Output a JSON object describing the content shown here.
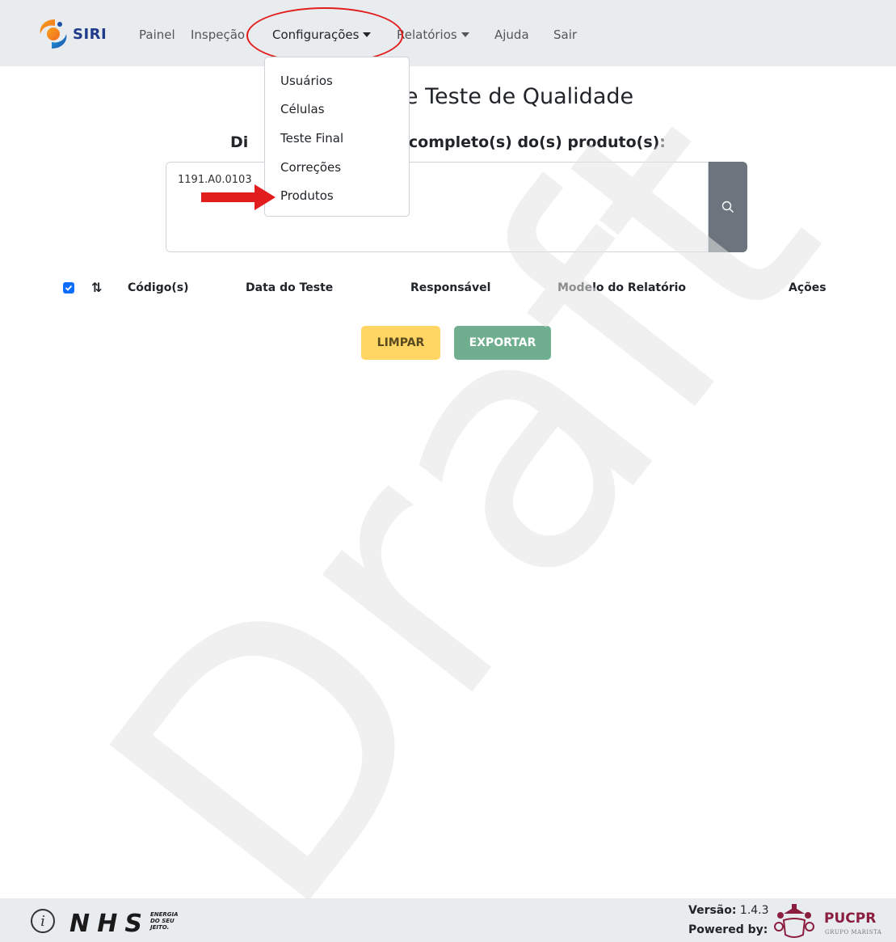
{
  "navbar": {
    "brand": "SIRI",
    "items": [
      {
        "label": "Painel"
      },
      {
        "label": "Inspeção"
      },
      {
        "label": "Configurações"
      },
      {
        "label": "Relatórios"
      },
      {
        "label": "Ajuda"
      },
      {
        "label": "Sair"
      }
    ]
  },
  "dropdown": {
    "items": [
      "Usuários",
      "Células",
      "Teste Final",
      "Correções",
      "Produtos"
    ]
  },
  "main": {
    "title": "e Teste de Qualidade",
    "subtitle": "Di                          s) completo(s) do(s) produto(s):",
    "search_value": "1191.A0.0103",
    "table_headers": [
      "Código(s)",
      "Data do Teste",
      "Responsável",
      "Modelo do Relatório",
      "Ações"
    ],
    "buttons": {
      "limpar": "LIMPAR",
      "exportar": "EXPORTAR"
    }
  },
  "watermark": "Draft",
  "footer": {
    "version_label": "Versão:",
    "version_value": "1.4.3",
    "powered_by": "Powered by:",
    "partner": "PUCPR",
    "partner_sub": "GRUPO MARISTA",
    "nhs_tagline": [
      "ENERGIA",
      "DO SEU",
      "JEITO."
    ]
  },
  "colors": {
    "navbar_bg": "#e9ecef",
    "limpar": "#ffd664",
    "exportar": "#6fae8f",
    "search_button": "#6c757d",
    "annotation": "#e11d1d"
  },
  "icons": [
    "siri-logo-icon",
    "search-icon",
    "checkbox-icon",
    "sort-icon",
    "info-icon",
    "red-arrow-icon",
    "pucpr-crest-icon"
  ]
}
